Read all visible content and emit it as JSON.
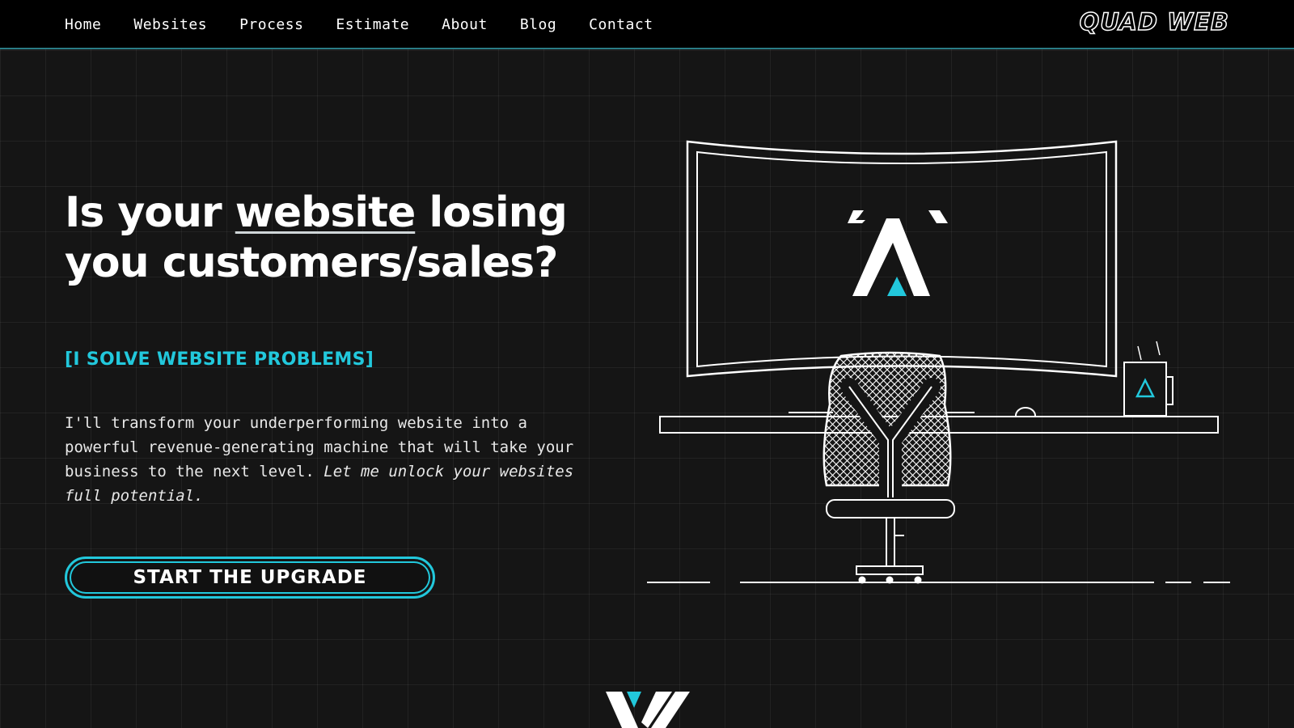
{
  "nav": {
    "items": [
      {
        "label": "Home"
      },
      {
        "label": "Websites"
      },
      {
        "label": "Process"
      },
      {
        "label": "Estimate"
      },
      {
        "label": "About"
      },
      {
        "label": "Blog"
      },
      {
        "label": "Contact"
      }
    ]
  },
  "brand": {
    "logo_text": "QUAD WEB"
  },
  "hero": {
    "title_part1": "Is your ",
    "title_highlight": "website",
    "title_part2": " losing you customers/sales?",
    "tagline": "[I SOLVE WEBSITE PROBLEMS]",
    "description": "I'll transform your underperforming website into a powerful revenue-generating machine that will take your business to the next level. ",
    "description_emphasis": "Let me unlock your websites full potential.",
    "cta_label": "START THE UPGRADE"
  },
  "colors": {
    "accent": "#22c8dc",
    "background": "#151515",
    "header": "#000000",
    "text": "#ffffff"
  },
  "icons": {
    "illustration": "desk-monitor-chair-illustration",
    "screen_logo": "quad-web-a-logo-icon",
    "mug": "coffee-mug-icon",
    "bottom": "scroll-down-v-logo-icon"
  }
}
